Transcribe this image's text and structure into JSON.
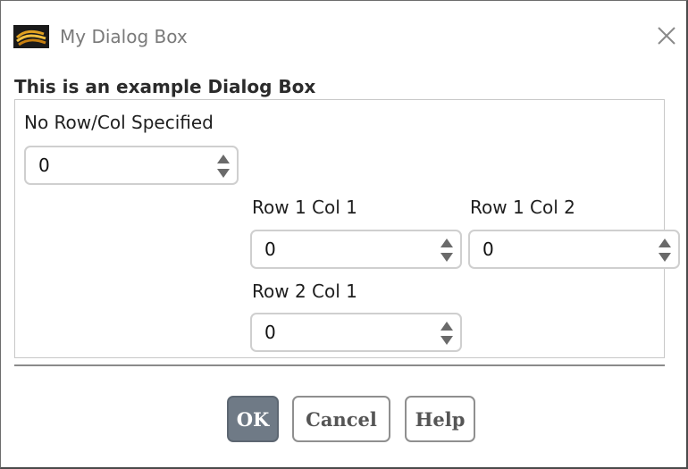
{
  "window": {
    "title": "My Dialog Box"
  },
  "icons": {
    "app": "app-logo-icon",
    "close": "close-icon",
    "spin": "spin-arrows-icon"
  },
  "group": {
    "header": "This is an example Dialog Box"
  },
  "fields": [
    {
      "label": "No Row/Col Specified",
      "value": "0"
    },
    {
      "label": "Row 1 Col 1",
      "value": "0"
    },
    {
      "label": "Row 1 Col 2",
      "value": "0"
    },
    {
      "label": "Row 2 Col 1",
      "value": "0"
    }
  ],
  "buttons": {
    "ok": "OK",
    "cancel": "Cancel",
    "help": "Help"
  },
  "colors": {
    "primary_button": "#6f7a86",
    "title_text": "#7a7a7a"
  }
}
